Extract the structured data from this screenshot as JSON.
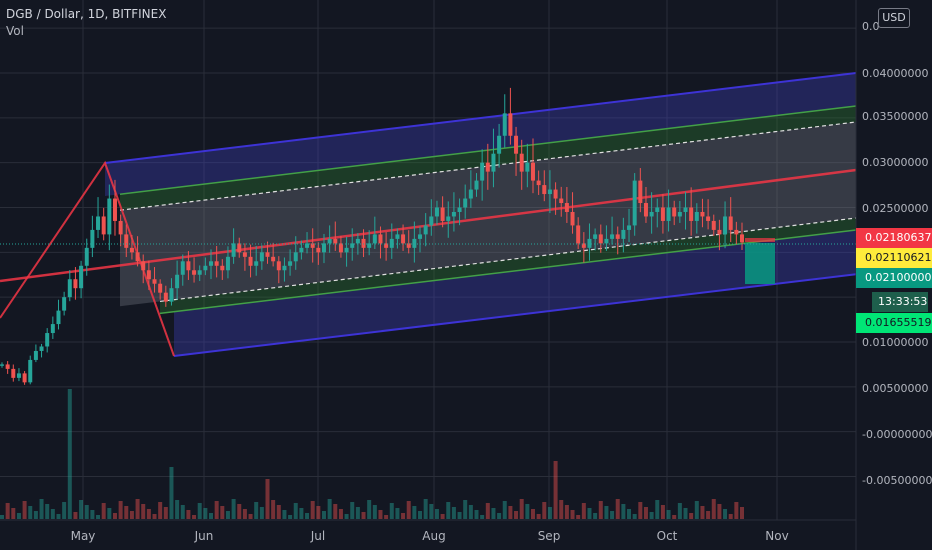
{
  "legend": {
    "symbol_line": "DGB / Dollar, 1D, BITFINEX",
    "vol_label": "Vol"
  },
  "toolbar": {
    "currency_label": "USD"
  },
  "colors": {
    "up": "#26a69a",
    "down": "#ef5350",
    "bg": "#131722",
    "grid": "#2a2e39",
    "pitchfork_outer": "#2962ff",
    "pitchfork_inner": "#4caf50",
    "median": "#f23645"
  },
  "price_badges": [
    {
      "label": "0.02180637",
      "color": "#f23645",
      "text_color": "#ffffff"
    },
    {
      "label": "0.02110621",
      "color": "#ffeb3b",
      "text_color": "#131722"
    },
    {
      "label": "0.02100000",
      "color": "#089981",
      "text_color": "#ffffff"
    },
    {
      "label": "13:33:53",
      "color": "#1e5f4c",
      "text_color": "#ffffff"
    },
    {
      "label": "0.01655519",
      "color": "#00e676",
      "text_color": "#131722"
    }
  ],
  "chart_data": {
    "type": "candlestick",
    "exchange": "BITFINEX",
    "pair": "DGB / Dollar",
    "interval": "1D",
    "y_ticks": [
      "0.04000000",
      "0.03500000",
      "0.03000000",
      "0.02500000",
      "0.01000000",
      "0.00500000",
      "-0.00000000",
      "-0.00500000"
    ],
    "y_top_partial": "0.0",
    "y_mid_partial": "0.",
    "x_ticks": [
      "May",
      "Jun",
      "Jul",
      "Aug",
      "Sep",
      "Oct",
      "Nov"
    ],
    "ylim": [
      -0.0075,
      0.0425
    ],
    "approx_close_series": [
      0.0075,
      0.007,
      0.006,
      0.0065,
      0.0055,
      0.008,
      0.009,
      0.0095,
      0.011,
      0.012,
      0.0135,
      0.015,
      0.017,
      0.016,
      0.0185,
      0.0205,
      0.0225,
      0.024,
      0.022,
      0.026,
      0.0235,
      0.022,
      0.0205,
      0.02,
      0.019,
      0.018,
      0.017,
      0.0165,
      0.0155,
      0.0145,
      0.016,
      0.0175,
      0.019,
      0.018,
      0.0175,
      0.018,
      0.0185,
      0.019,
      0.0185,
      0.018,
      0.0195,
      0.021,
      0.02,
      0.0195,
      0.0185,
      0.019,
      0.02,
      0.0195,
      0.019,
      0.018,
      0.0185,
      0.019,
      0.02,
      0.0205,
      0.021,
      0.0205,
      0.02,
      0.021,
      0.0215,
      0.021,
      0.02,
      0.0205,
      0.021,
      0.0215,
      0.0205,
      0.021,
      0.022,
      0.021,
      0.0205,
      0.0215,
      0.022,
      0.021,
      0.0205,
      0.0215,
      0.022,
      0.023,
      0.024,
      0.025,
      0.0235,
      0.024,
      0.0245,
      0.025,
      0.026,
      0.027,
      0.028,
      0.03,
      0.029,
      0.031,
      0.033,
      0.0355,
      0.033,
      0.031,
      0.029,
      0.03,
      0.028,
      0.0275,
      0.0265,
      0.027,
      0.026,
      0.0255,
      0.0245,
      0.023,
      0.021,
      0.0205,
      0.0215,
      0.022,
      0.021,
      0.0215,
      0.022,
      0.0215,
      0.0225,
      0.023,
      0.028,
      0.0255,
      0.024,
      0.0245,
      0.025,
      0.0235,
      0.025,
      0.024,
      0.0245,
      0.025,
      0.0235,
      0.0245,
      0.024,
      0.0235,
      0.0225,
      0.022,
      0.024,
      0.0225,
      0.022,
      0.02110621
    ],
    "volume_spikes": {
      "late_april": 0.0,
      "mid_may": 0.0,
      "late_july": 0.0
    }
  }
}
